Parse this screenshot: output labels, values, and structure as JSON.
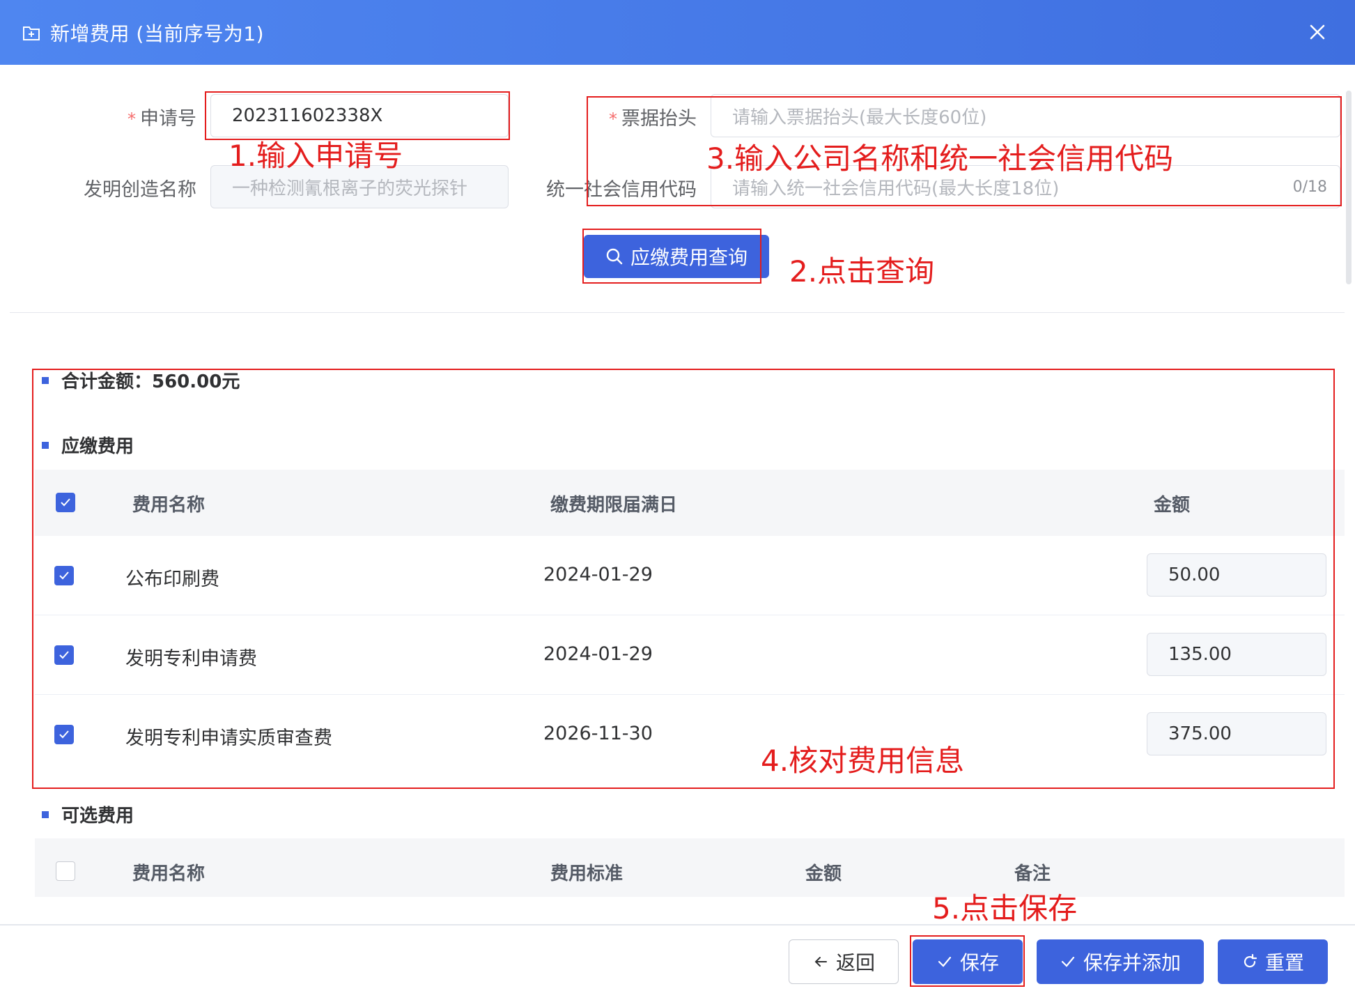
{
  "dialog": {
    "title": "新增费用 (当前序号为1)"
  },
  "form": {
    "application_no": {
      "label": "申请号",
      "value": "202311602338X"
    },
    "invention_name": {
      "label": "发明创造名称",
      "value": "一种检测氰根离子的荧光探针"
    },
    "invoice_title": {
      "label": "票据抬头",
      "placeholder": "请输入票据抬头(最大长度60位)"
    },
    "credit_code": {
      "label": "统一社会信用代码",
      "placeholder": "请输入统一社会信用代码(最大长度18位)",
      "counter": "0/18"
    },
    "query_button": "应缴费用查询"
  },
  "annotations": {
    "step1": "1.输入申请号",
    "step2": "2.点击查询",
    "step3": "3.输入公司名称和统一社会信用代码",
    "step4": "4.核对费用信息",
    "step5": "5.点击保存"
  },
  "total": {
    "label": "合计金额：560.00元"
  },
  "required_fees": {
    "title": "应缴费用",
    "columns": [
      "费用名称",
      "缴费期限届满日",
      "金额"
    ],
    "rows": [
      {
        "name": "公布印刷费",
        "deadline": "2024-01-29",
        "amount": "50.00"
      },
      {
        "name": "发明专利申请费",
        "deadline": "2024-01-29",
        "amount": "135.00"
      },
      {
        "name": "发明专利申请实质审查费",
        "deadline": "2026-11-30",
        "amount": "375.00"
      }
    ]
  },
  "optional_fees": {
    "title": "可选费用",
    "columns": [
      "费用名称",
      "费用标准",
      "金额",
      "备注"
    ]
  },
  "footer": {
    "back": "返回",
    "save": "保存",
    "save_add": "保存并添加",
    "reset": "重置"
  },
  "colors": {
    "primary": "#3d63dd",
    "annotation": "#e41d1d",
    "required": "#f56c6c"
  }
}
